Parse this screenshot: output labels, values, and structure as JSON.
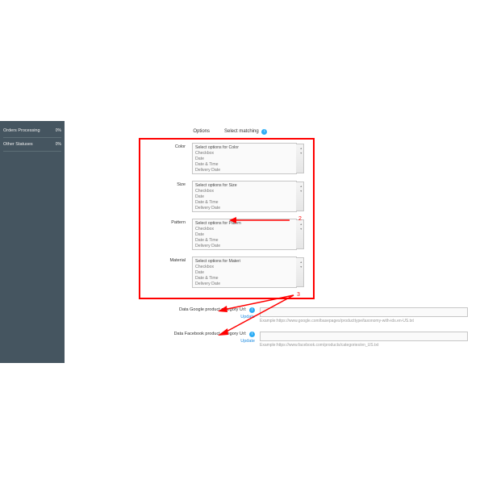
{
  "sidebar": {
    "items": [
      {
        "label": "Orders Processing",
        "pct": "0%"
      },
      {
        "label": "Other Statuses",
        "pct": "0%"
      }
    ]
  },
  "headers": {
    "options": "Options",
    "matching": "Select matching"
  },
  "option_rows": [
    {
      "key": "color",
      "label": "Color",
      "first": "Select options for Color"
    },
    {
      "key": "size",
      "label": "Size",
      "first": "Select options for Size"
    },
    {
      "key": "pattern",
      "label": "Pattern",
      "first": "Select options for Patern"
    },
    {
      "key": "material",
      "label": "Material",
      "first": "Select options for Materi"
    }
  ],
  "common_opts": [
    "Checkbox",
    "Date",
    "Date & Time",
    "Delivery Date"
  ],
  "url_rows": [
    {
      "label": "Data Google product category Url:",
      "example": "Example:https://www.google.com/basepages/producttype/taxonomy-with-ids.en-US.txt"
    },
    {
      "label": "Data Facebook product category Url:",
      "example": "Example:https://www.facebook.com/products/categories/en_US.txt"
    }
  ],
  "update_text": "Update",
  "annotations": {
    "a": "2",
    "b": "3"
  }
}
